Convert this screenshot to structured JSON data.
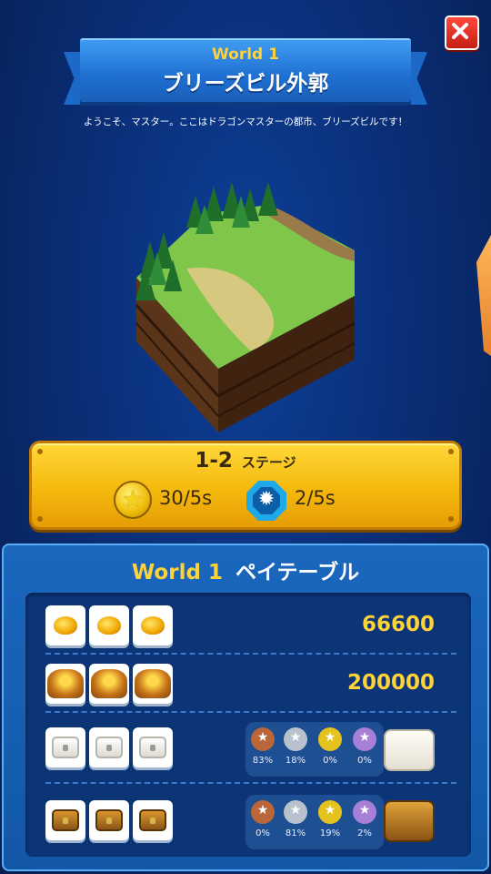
{
  "header": {
    "world": "World 1",
    "title": "ブリーズビル外郭",
    "welcome": "ようこそ、マスター。ここはドラゴンマスターの都市、ブリーズビルです！",
    "close_icon": "close-icon"
  },
  "stage": {
    "number": "1-2",
    "label": "ステージ",
    "star_value": "30/5s",
    "gem_value": "2/5s"
  },
  "paytable": {
    "world": "World 1",
    "title": "ペイテーブル",
    "rows": [
      {
        "symbol": "gold-coins",
        "payout": "66600"
      },
      {
        "symbol": "treasure-chest-gold",
        "payout": "200000"
      },
      {
        "symbol": "white-chest",
        "odds": [
          "83%",
          "18%",
          "0%",
          "0%"
        ]
      },
      {
        "symbol": "wooden-chest",
        "odds": [
          "0%",
          "81%",
          "19%",
          "2%"
        ]
      }
    ],
    "medal_colors": [
      "#b8663a",
      "#b9c2cc",
      "#e6c21e",
      "#a77fd6"
    ]
  }
}
